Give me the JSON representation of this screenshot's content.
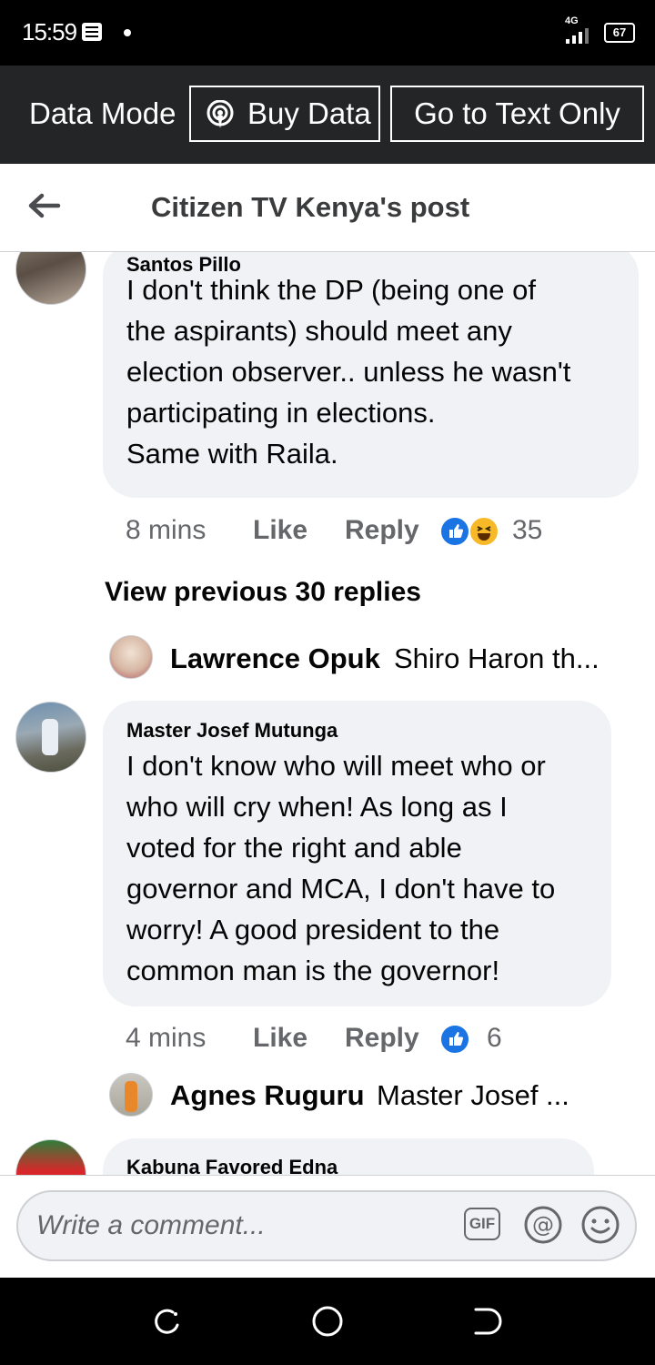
{
  "status": {
    "time": "15:59",
    "network": "4G",
    "battery": "67"
  },
  "databar": {
    "label": "Data Mode",
    "buy_data": "Buy Data",
    "text_only": "Go to Text Only"
  },
  "header": {
    "title": "Citizen TV Kenya's post"
  },
  "comments": [
    {
      "name": "Santos Pillo",
      "text": "I don't think the DP (being one of\nthe  aspirants) should meet any\nelection observer.. unless he wasn't\nparticipating in elections.\nSame with Raila.",
      "time": "8 mins",
      "like": "Like",
      "reply": "Reply",
      "reactions": "35"
    },
    {
      "name": "Master Josef Mutunga",
      "text": "I don't know who will meet who or\nwho will cry when! As long as I\nvoted for the right and able\ngovernor and MCA, I don't have to\nworry! A good president to the\ncommon man is the governor!",
      "time": "4 mins",
      "like": "Like",
      "reply": "Reply",
      "reactions": "6"
    },
    {
      "name": "Kabuna Favored Edna"
    }
  ],
  "view_previous": "View previous 30 replies",
  "replies": [
    {
      "name": "Lawrence Opuk",
      "text": "Shiro Haron th..."
    },
    {
      "name": "Agnes Ruguru",
      "text": "Master Josef ..."
    }
  ],
  "compose": {
    "placeholder": "Write a comment...",
    "gif": "GIF"
  },
  "colors": {
    "like_blue": "#1b74e4",
    "haha_yellow": "#f7b928",
    "bubble": "#f0f2f5",
    "header_dark": "#242526"
  }
}
